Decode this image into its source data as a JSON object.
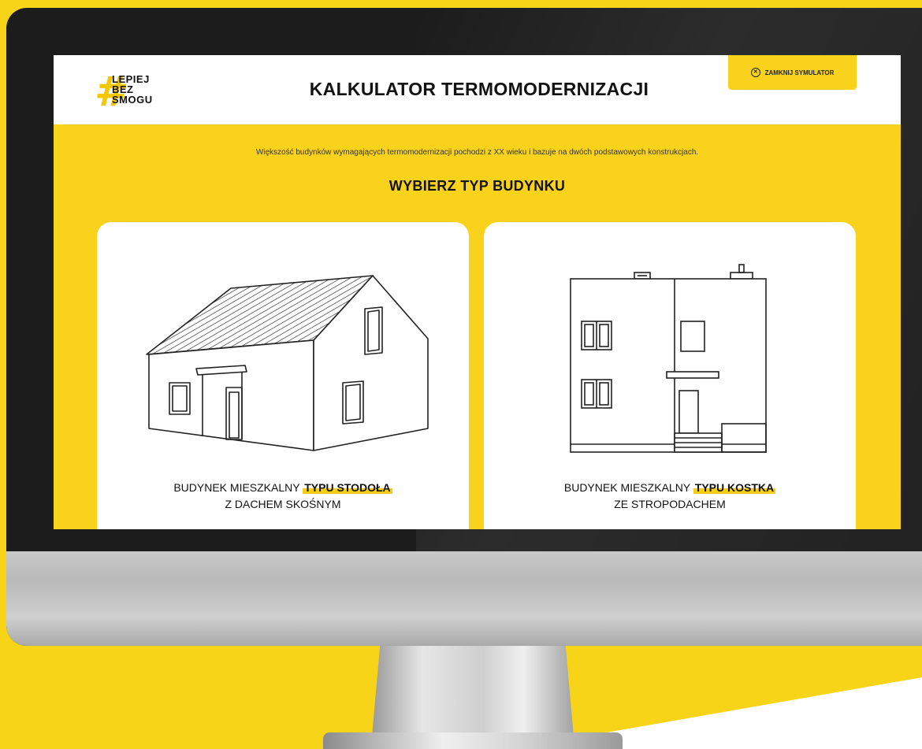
{
  "header": {
    "logo_lines": [
      "LEPIEJ",
      "BEZ",
      "SMOGU"
    ],
    "logo_hash": "#",
    "title": "KALKULATOR TERMOMODERNIZACJI",
    "close_label": "ZAMKNIJ SYMULATOR",
    "close_icon": "close-circle-icon"
  },
  "intro": "Większość budynków wymagających termomodernizacji pochodzi z XX wieku i bazuje na dwóch podstawowych konstrukcjach.",
  "heading": "WYBIERZ TYP BUDYNKU",
  "cards": [
    {
      "line1_plain": "BUDYNEK MIESZKALNY ",
      "line1_highlight": "TYPU STODOŁA",
      "line2": "Z DACHEM SKOŚNYM",
      "illustration": "gable-roof-house-icon"
    },
    {
      "line1_plain": "BUDYNEK MIESZKALNY ",
      "line1_highlight": "TYPU KOSTKA",
      "line2": "ZE STROPODACHEM",
      "illustration": "flat-roof-house-icon"
    }
  ],
  "colors": {
    "brand_yellow": "#f9d21c",
    "text_dark": "#121212",
    "card_bg": "#ffffff"
  }
}
